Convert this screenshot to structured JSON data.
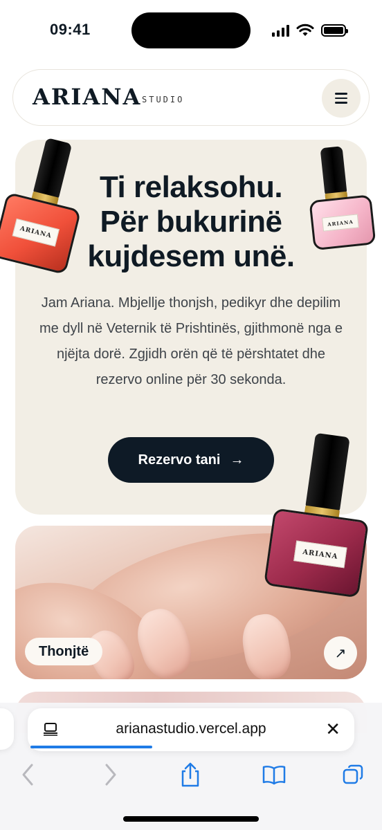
{
  "status_bar": {
    "time": "09:41"
  },
  "header": {
    "logo": "ARIANA",
    "logo_sub": "STUDIO",
    "menu_icon": "hamburger-icon"
  },
  "hero": {
    "title_lines": [
      "Ti relaksohu.",
      "Për bukurinë",
      "kujdesem unë."
    ],
    "description": "Jam Ariana. Mbjellje thonjsh, pedikyr dhe depilim me dyll në Veternik të Prishtinës, gjithmonë nga e njëjta dorë. Zgjidh orën që të përshtatet dhe rezervo online për 30 sekonda.",
    "cta_label": "Rezervo tani",
    "cta_icon": "arrow-right-icon",
    "bottle_label": "ARIANA",
    "colors": {
      "background": "#f2eee5",
      "cta": "#0e1a26"
    }
  },
  "services": [
    {
      "tag": "Thonjtë",
      "icon": "arrow-up-right-icon"
    }
  ],
  "browser": {
    "url": "arianastudio.vercel.app",
    "load_progress": 0.38,
    "accent": "#1f7be6",
    "toolbar_icons": [
      "back-icon",
      "forward-icon",
      "share-icon",
      "bookmarks-icon",
      "tabs-icon"
    ]
  }
}
